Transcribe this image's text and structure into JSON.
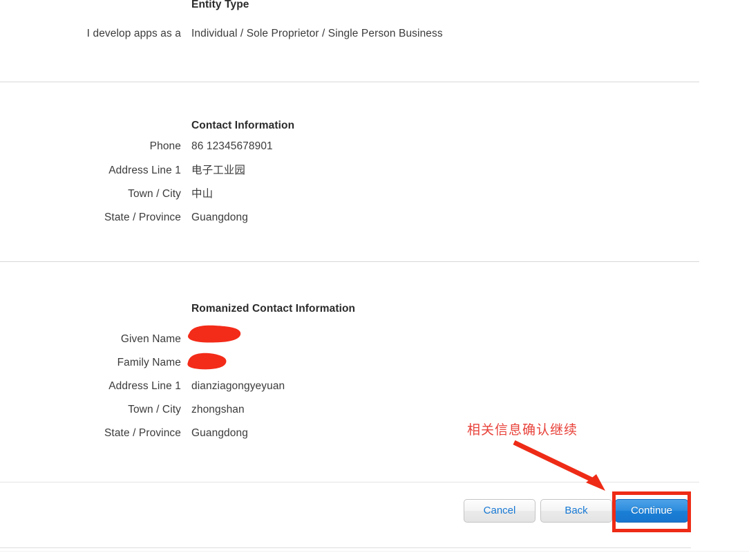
{
  "page": {
    "accent_blue": "#1876cf",
    "annotation_red": "#e8423a",
    "highlight_red": "#ee2b16",
    "redaction_red": "#f32b19"
  },
  "entity_type_section": {
    "heading": "Entity Type",
    "rows": [
      {
        "label": "I develop apps as a",
        "value": "Individual / Sole Proprietor / Single Person Business"
      }
    ]
  },
  "contact_information_section": {
    "heading": "Contact Information",
    "rows": [
      {
        "label": "Phone",
        "value": "86 12345678901"
      },
      {
        "label": "Address Line 1",
        "value": "电子工业园"
      },
      {
        "label": "Town / City",
        "value": "中山"
      },
      {
        "label": "State / Province",
        "value": "Guangdong"
      }
    ]
  },
  "romanized_contact_information_section": {
    "heading": "Romanized Contact Information",
    "rows": [
      {
        "label": "Given Name",
        "value": "",
        "redacted": true
      },
      {
        "label": "Family Name",
        "value": "",
        "redacted": true
      },
      {
        "label": "Address Line 1",
        "value": "dianziagongyeyuan"
      },
      {
        "label": "Town / City",
        "value": "zhongshan"
      },
      {
        "label": "State / Province",
        "value": "Guangdong"
      }
    ]
  },
  "button_bar": {
    "cancel_label": "Cancel",
    "back_label": "Back",
    "continue_label": "Continue"
  },
  "annotations": {
    "note_text": "相关信息确认继续"
  }
}
